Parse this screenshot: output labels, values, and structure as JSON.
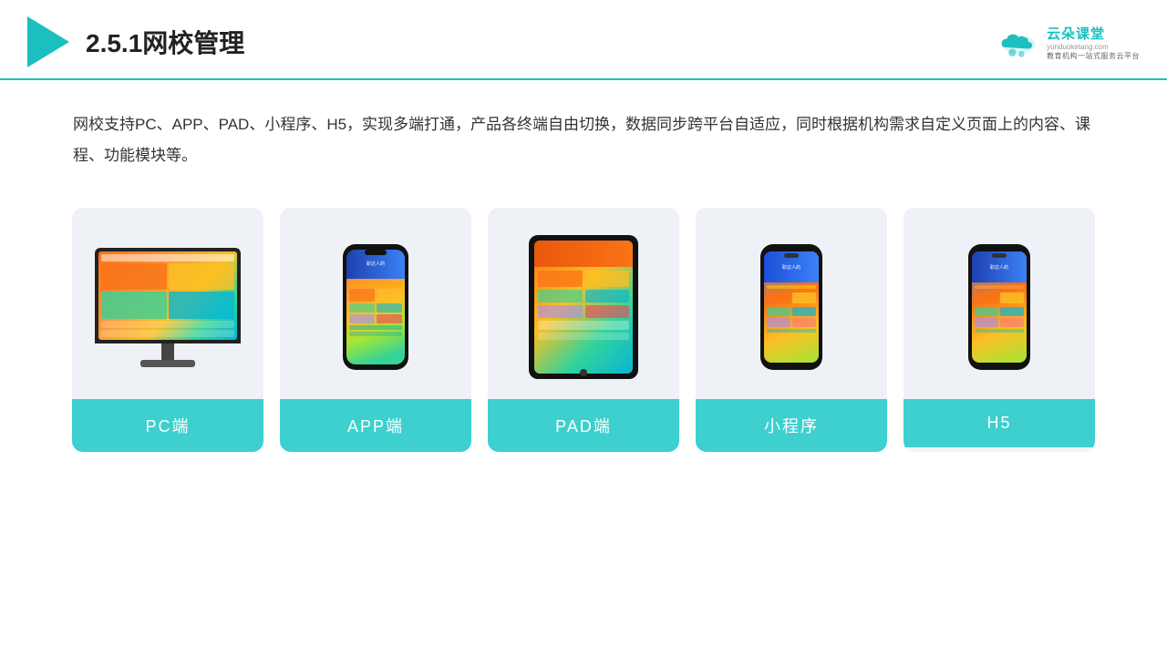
{
  "header": {
    "section_number": "2.5.1",
    "title": "网校管理",
    "logo_name": "云朵课堂",
    "logo_url": "yunduoketang.com",
    "logo_tagline": "教育机构一站式服务云平台"
  },
  "description": {
    "text": "网校支持PC、APP、PAD、小程序、H5，实现多端打通，产品各终端自由切换，数据同步跨平台自适应，同时根据机构需求自定义页面上的内容、课程、功能模块等。"
  },
  "cards": [
    {
      "id": "pc",
      "label": "PC端"
    },
    {
      "id": "app",
      "label": "APP端"
    },
    {
      "id": "pad",
      "label": "PAD端"
    },
    {
      "id": "miniprogram",
      "label": "小程序"
    },
    {
      "id": "h5",
      "label": "H5"
    }
  ],
  "colors": {
    "teal": "#3ecfcf",
    "header_line": "#1cbfbf",
    "card_bg": "#eef2f7",
    "text_dark": "#222",
    "text_body": "#333"
  }
}
